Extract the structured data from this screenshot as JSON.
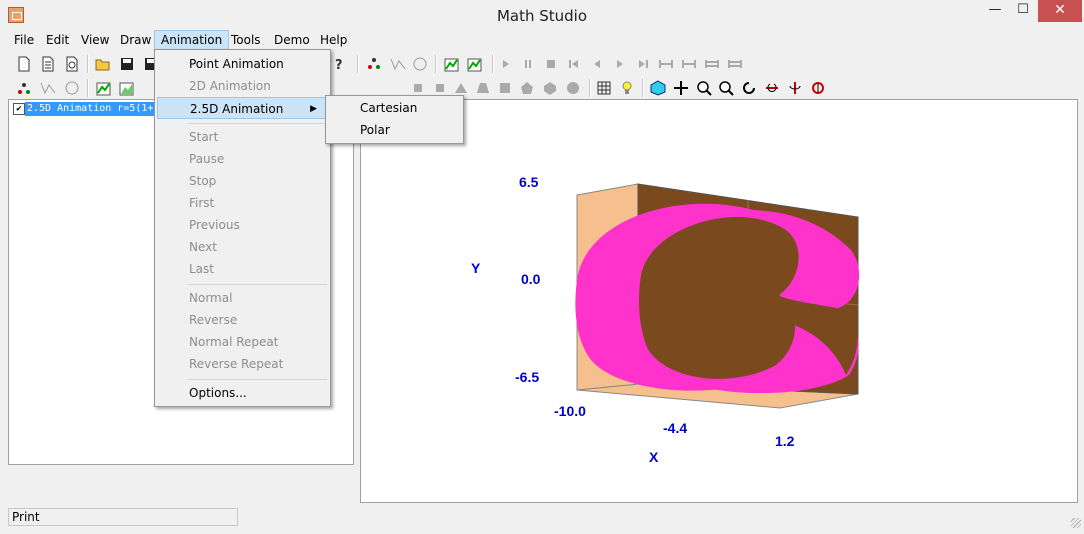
{
  "window": {
    "title": "Math Studio",
    "minimize": "—",
    "maximize": "☐",
    "close": "✕"
  },
  "menubar": {
    "items": [
      "File",
      "Edit",
      "View",
      "Draw",
      "Animation",
      "Tools",
      "Demo",
      "Help"
    ]
  },
  "tree": {
    "item_label": "2.5D Animation  r=5(1+",
    "checked_mark": "✔"
  },
  "animation_menu": {
    "point_animation": "Point Animation",
    "anim_2d": "2D Animation",
    "anim_25d": "2.5D Animation",
    "start": "Start",
    "pause": "Pause",
    "stop": "Stop",
    "first": "First",
    "previous": "Previous",
    "next": "Next",
    "last": "Last",
    "normal": "Normal",
    "reverse": "Reverse",
    "normal_repeat": "Normal Repeat",
    "reverse_repeat": "Reverse Repeat",
    "options": "Options..."
  },
  "submenu_25d": {
    "cartesian": "Cartesian",
    "polar": "Polar"
  },
  "plot": {
    "y_axis_label": "Y",
    "x_axis_label": "X",
    "y_ticks": [
      "6.5",
      "0.0",
      "-6.5"
    ],
    "x_ticks": [
      "-10.0",
      "-4.4",
      "1.2"
    ],
    "colors": {
      "surface": "#ff33cc",
      "back_wall": "#7a4a1e",
      "floor": "#f5c08e",
      "axis_text": "#0000cc"
    }
  },
  "status": {
    "text": "Print"
  },
  "toolbar_icons": [
    "new-icon",
    "new-doc-icon",
    "new-copy-icon",
    "open-folder-icon",
    "save-icon",
    "save-as-icon",
    "help-icon",
    "point-icon",
    "curve-icon",
    "polar-icon",
    "chart-add-icon",
    "chart-edit-icon",
    "play-icon",
    "pause-icon",
    "stop-icon",
    "first-icon",
    "previous-icon",
    "next-icon",
    "last-icon",
    "normal-icon",
    "reverse-icon",
    "normal-repeat-icon",
    "reverse-repeat-icon",
    "grid-icon",
    "light-bulb-icon",
    "cube-icon",
    "move-icon",
    "zoom-in-icon",
    "zoom-out-icon",
    "rotate-icon",
    "rotate-x-icon",
    "rotate-y-icon",
    "rotate-z-icon"
  ]
}
